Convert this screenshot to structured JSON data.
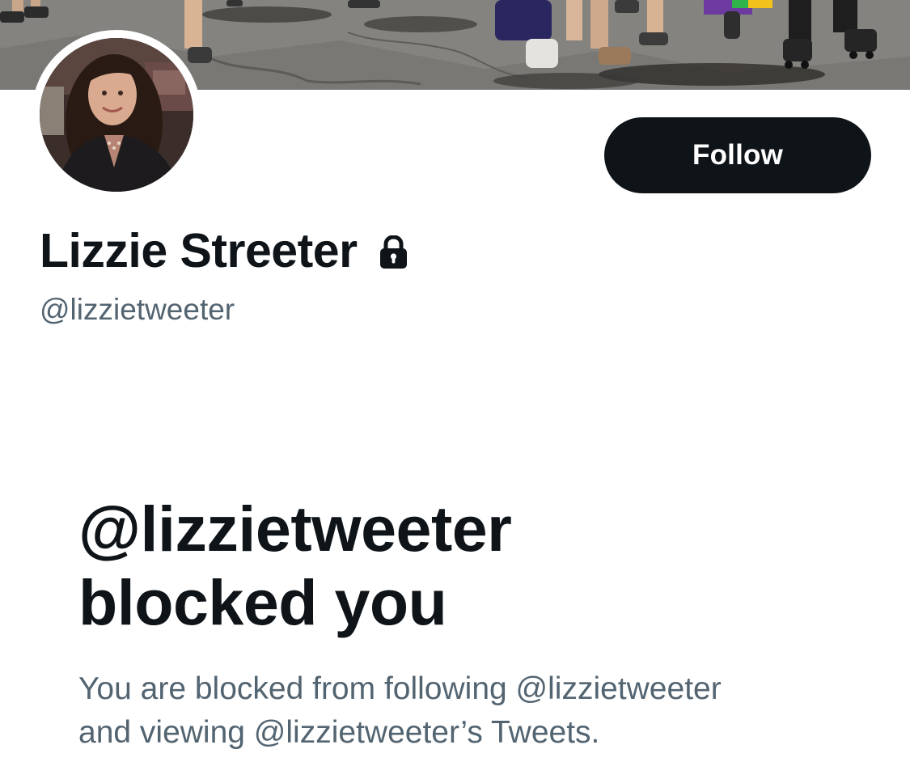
{
  "profile": {
    "display_name": "Lizzie Streeter",
    "handle": "@lizzietweeter",
    "protected_icon": "lock-icon",
    "banner": "parade-street-photo",
    "avatar": "profile-photo"
  },
  "actions": {
    "follow_label": "Follow"
  },
  "blocked_notice": {
    "title_line1": "@lizzietweeter",
    "title_line2": "blocked you",
    "desc_line1": "You are blocked from following @lizzietweeter",
    "desc_line2": "and viewing @lizzietweeter’s Tweets."
  },
  "colors": {
    "text_primary": "#0f1419",
    "text_secondary": "#536471",
    "button_bg": "#0f1419",
    "button_text": "#ffffff",
    "background": "#ffffff"
  }
}
